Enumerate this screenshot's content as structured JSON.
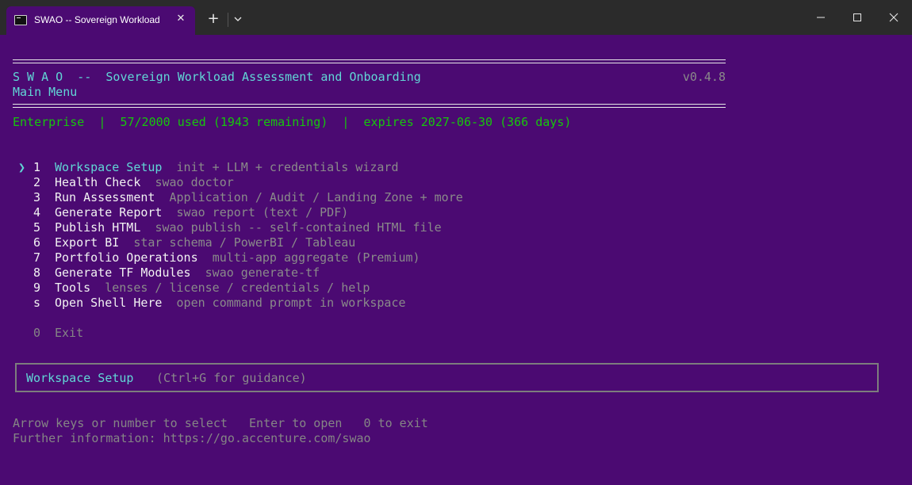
{
  "window": {
    "tab_title": "SWAO -- Sovereign Workload",
    "tab_close_glyph": "✕",
    "new_tab_glyph": "+",
    "icons": [
      "terminal-icon",
      "close-icon",
      "plus-icon",
      "chevron-down-icon",
      "minimize-icon",
      "maximize-icon",
      "window-close-icon"
    ]
  },
  "header": {
    "title": "S W A O  --  Sovereign Workload Assessment and Onboarding",
    "version": "v0.4.8",
    "subtitle": "Main Menu",
    "license": "Enterprise  |  57/2000 used (1943 remaining)  |  expires 2027-06-30 (366 days)"
  },
  "menu": {
    "cursor": "❯",
    "items": [
      {
        "key": "1",
        "label": "Workspace Setup",
        "desc": "init + LLM + credentials wizard",
        "selected": true
      },
      {
        "key": "2",
        "label": "Health Check",
        "desc": "swao doctor"
      },
      {
        "key": "3",
        "label": "Run Assessment",
        "desc": "Application / Audit / Landing Zone + more"
      },
      {
        "key": "4",
        "label": "Generate Report",
        "desc": "swao report (text / PDF)"
      },
      {
        "key": "5",
        "label": "Publish HTML",
        "desc": "swao publish -- self-contained HTML file"
      },
      {
        "key": "6",
        "label": "Export BI",
        "desc": "star schema / PowerBI / Tableau"
      },
      {
        "key": "7",
        "label": "Portfolio Operations",
        "desc": "multi-app aggregate (Premium)"
      },
      {
        "key": "8",
        "label": "Generate TF Modules",
        "desc": "swao generate-tf"
      },
      {
        "key": "9",
        "label": "Tools",
        "desc": "lenses / license / credentials / help"
      },
      {
        "key": "s",
        "label": "Open Shell Here",
        "desc": "open command prompt in workspace"
      }
    ],
    "exit": {
      "key": "0",
      "label": "Exit"
    }
  },
  "hint": {
    "title": "Workspace Setup",
    "guidance": "(Ctrl+G for guidance)"
  },
  "footer": {
    "keys": "Arrow keys or number to select   Enter to open   0 to exit",
    "info": "Further information: https://go.accenture.com/swao"
  },
  "colors": {
    "background": "#4b0a72",
    "titlebar": "#2b2b2b",
    "accent_cyan": "#61d6d6",
    "license_green": "#16c60c",
    "dim_gray": "#8a8a8a",
    "text_white": "#f2f2f2"
  }
}
